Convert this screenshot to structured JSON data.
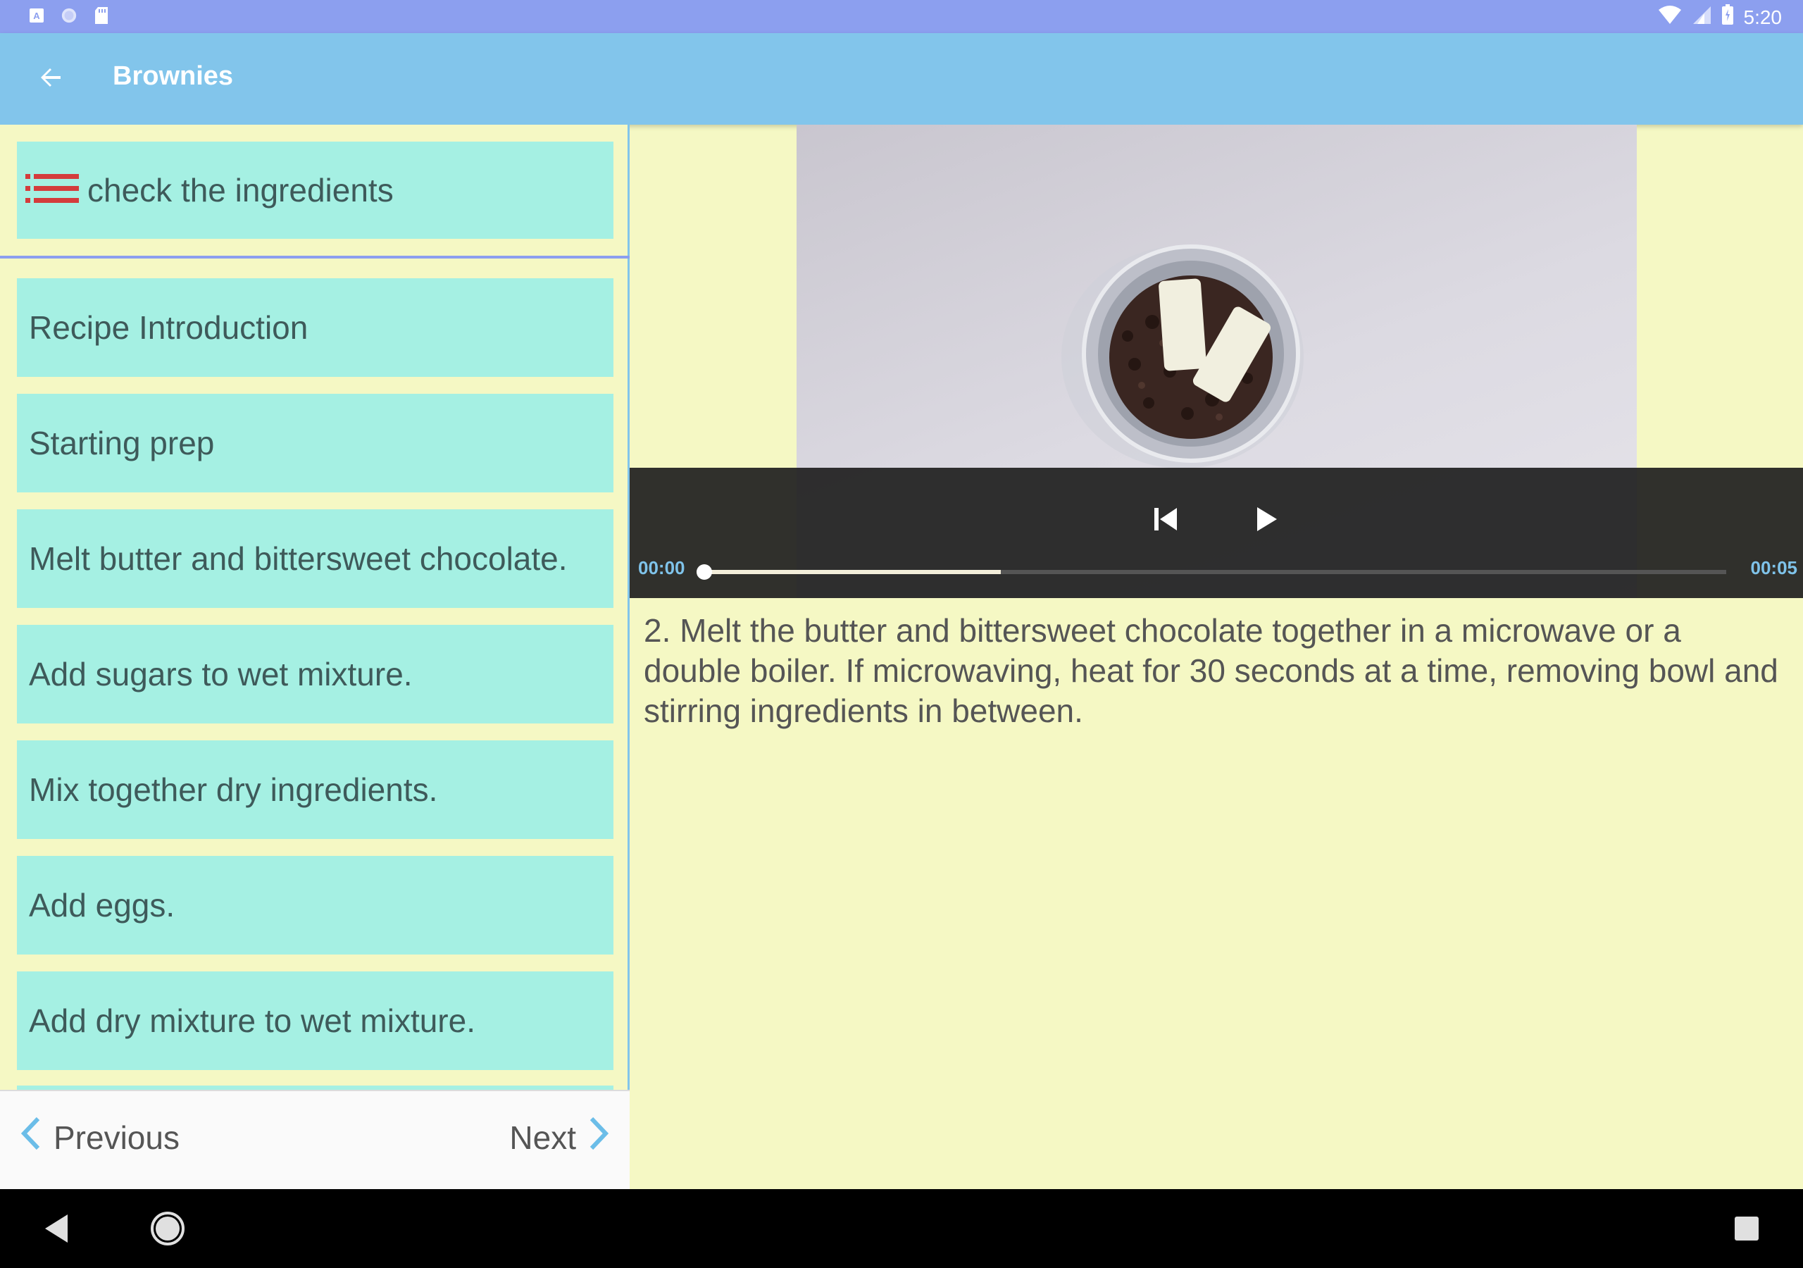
{
  "status_bar": {
    "left_icons": [
      "a-notification-icon",
      "circle-notification-icon",
      "sd-card-icon"
    ],
    "right_icons": [
      "wifi-icon",
      "signal-icon",
      "battery-icon"
    ],
    "time": "5:20"
  },
  "app_bar": {
    "back_icon": "arrow-back-icon",
    "title": "Brownies"
  },
  "ingredients_card": {
    "icon": "list-icon",
    "label": "check the ingredients",
    "accent_color": "#d43c3c"
  },
  "steps": [
    {
      "label": "Recipe Introduction"
    },
    {
      "label": "Starting prep"
    },
    {
      "label": "Melt butter and bittersweet chocolate."
    },
    {
      "label": "Add sugars to wet mixture."
    },
    {
      "label": "Mix together dry ingredients."
    },
    {
      "label": "Add eggs."
    },
    {
      "label": "Add dry mixture to wet mixture."
    }
  ],
  "navigation": {
    "previous_label": "Previous",
    "next_label": "Next",
    "previous_icon": "chevron-left-icon",
    "next_icon": "chevron-right-icon"
  },
  "player": {
    "current_time": "00:00",
    "duration": "00:05",
    "progress_fraction": 0.0,
    "buffered_fraction": 0.29,
    "controls": [
      "skip-previous-icon",
      "play-icon"
    ]
  },
  "step_description": "2. Melt the butter and bittersweet chocolate together in a microwave or a double boiler. If microwaving, heat for 30 seconds at a time, removing bowl and stirring ingredients in between.",
  "system_nav": [
    "back-triangle-icon",
    "home-circle-icon",
    "recents-square-icon"
  ],
  "colors": {
    "status_bar": "#8c9fef",
    "app_bar": "#82c5eb",
    "background": "#f5f8c4",
    "card": "#a5f0e3",
    "accent_time": "#7fc3ea"
  }
}
